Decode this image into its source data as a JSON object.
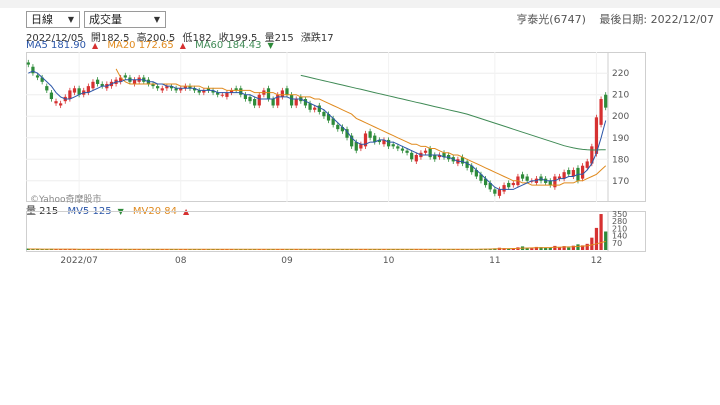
{
  "toolbar": {
    "period_select": "日線",
    "indicator_select": "成交量"
  },
  "stock": {
    "name": "亨泰光(6747)",
    "last_date_label": "最後日期: 2022/12/07"
  },
  "ohlc": {
    "date": "2022/12/05",
    "open": "開182.5",
    "high": "高200.5",
    "low": "低182",
    "close": "收199.5",
    "volume": "量215",
    "change": "漲跌17"
  },
  "ma_legend": {
    "ma5": "MA5 181.90",
    "ma20": "MA20 172.65",
    "ma60": "MA60 184.43"
  },
  "vol_legend": {
    "vol": "量 215",
    "mv5": "MV5 125",
    "mv20": "MV20 84"
  },
  "watermark": "©Yahoo奇摩股市",
  "colors": {
    "up": "#d63131",
    "down": "#2e8b3a",
    "ma5": "#2b56a8",
    "ma20": "#e08a1e",
    "ma60": "#3f8a55",
    "vol_ma": "#e08a1e"
  },
  "chart_data": {
    "type": "candlestick",
    "price_ticks": [
      "220",
      "210",
      "200",
      "190",
      "180",
      "170"
    ],
    "volume_ticks": [
      "350",
      "280",
      "210",
      "140",
      "70"
    ],
    "x_ticks": [
      "2022/07",
      "08",
      "09",
      "10",
      "11",
      "12"
    ],
    "x_tick_index": [
      11,
      33,
      56,
      78,
      101,
      123
    ],
    "ylim": [
      162,
      228
    ],
    "vlim": [
      0,
      360
    ],
    "close": [
      224,
      220,
      218,
      216,
      212,
      208,
      207,
      206,
      209,
      212,
      213,
      210,
      212,
      214,
      216,
      215,
      214,
      215,
      216,
      217,
      218,
      218,
      216,
      217,
      218,
      216,
      215,
      214,
      213,
      213,
      214,
      213,
      212,
      213,
      214,
      213,
      212,
      211,
      212,
      212,
      211,
      210,
      210,
      211,
      212,
      212,
      210,
      208,
      207,
      205,
      210,
      212,
      208,
      205,
      210,
      212,
      210,
      205,
      208,
      207,
      205,
      203,
      204,
      202,
      200,
      198,
      196,
      194,
      193,
      190,
      186,
      184,
      187,
      192,
      190,
      188,
      188,
      189,
      186,
      186,
      185,
      184,
      183,
      180,
      182,
      183,
      184,
      181,
      180,
      182,
      181,
      180,
      179,
      180,
      178,
      176,
      174,
      172,
      170,
      168,
      166,
      164,
      166,
      168,
      167,
      169,
      172,
      171,
      170,
      170,
      171,
      170,
      169,
      168,
      172,
      172,
      174,
      173,
      175,
      170,
      177,
      179,
      186,
      199.5,
      208,
      204
    ],
    "open": [
      225,
      223,
      219,
      218,
      214,
      211,
      206,
      205,
      207,
      208,
      211,
      213,
      210,
      211,
      213,
      217,
      215,
      213,
      214,
      215,
      216,
      219,
      218,
      215,
      216,
      218,
      217,
      215,
      214,
      212,
      213,
      214,
      213,
      212,
      213,
      214,
      213,
      212,
      211,
      213,
      212,
      211,
      210,
      209,
      211,
      213,
      213,
      210,
      209,
      208,
      205,
      210,
      213,
      208,
      205,
      209,
      213,
      210,
      205,
      209,
      208,
      206,
      203,
      205,
      202,
      201,
      199,
      196,
      195,
      194,
      191,
      188,
      185,
      186,
      193,
      191,
      189,
      187,
      189,
      187,
      186,
      185,
      184,
      183,
      179,
      181,
      183,
      185,
      182,
      181,
      183,
      182,
      181,
      178,
      181,
      179,
      177,
      175,
      173,
      171,
      169,
      166,
      163,
      165,
      169,
      168,
      168,
      173,
      172,
      170,
      169,
      172,
      171,
      170,
      167,
      171,
      171,
      175,
      172,
      176,
      171,
      176,
      178,
      182.5,
      196,
      210
    ],
    "volume": [
      14,
      10,
      9,
      9,
      8,
      11,
      9,
      8,
      10,
      9,
      8,
      8,
      7,
      9,
      8,
      8,
      7,
      7,
      8,
      8,
      7,
      8,
      7,
      7,
      8,
      7,
      7,
      7,
      7,
      6,
      7,
      7,
      7,
      6,
      7,
      6,
      6,
      7,
      7,
      6,
      6,
      6,
      7,
      6,
      7,
      6,
      7,
      7,
      8,
      8,
      9,
      8,
      7,
      8,
      8,
      7,
      8,
      9,
      8,
      8,
      7,
      8,
      7,
      8,
      7,
      8,
      7,
      9,
      8,
      8,
      9,
      9,
      8,
      7,
      9,
      8,
      8,
      7,
      8,
      7,
      8,
      8,
      7,
      9,
      8,
      8,
      7,
      8,
      8,
      7,
      7,
      8,
      8,
      7,
      7,
      8,
      9,
      9,
      10,
      12,
      14,
      16,
      22,
      18,
      14,
      15,
      26,
      35,
      20,
      18,
      30,
      28,
      20,
      22,
      40,
      30,
      38,
      25,
      42,
      55,
      45,
      60,
      120,
      215,
      350,
      180
    ],
    "ma5": [
      220,
      221,
      220,
      218,
      216,
      214,
      211,
      209,
      208,
      208,
      209,
      210,
      211,
      211,
      212,
      213,
      214,
      214,
      215,
      216,
      216,
      217,
      217,
      217,
      217,
      217,
      216,
      216,
      215,
      215,
      214,
      214,
      213,
      213,
      213,
      213,
      213,
      212,
      212,
      212,
      212,
      211,
      211,
      211,
      211,
      211,
      211,
      210,
      210,
      209,
      208,
      208,
      208,
      208,
      209,
      209,
      209,
      208,
      208,
      208,
      207,
      206,
      205,
      204,
      203,
      201,
      199,
      197,
      195,
      193,
      190,
      188,
      187,
      187,
      188,
      188,
      189,
      189,
      188,
      188,
      187,
      186,
      185,
      184,
      183,
      182,
      182,
      182,
      182,
      182,
      181,
      181,
      180,
      179,
      179,
      178,
      177,
      175,
      173,
      171,
      169,
      167,
      166,
      166,
      166,
      166,
      167,
      168,
      169,
      170,
      170,
      171,
      170,
      170,
      170,
      171,
      171,
      172,
      172,
      173,
      173,
      175,
      178,
      183,
      190,
      198
    ],
    "ma20": [
      null,
      null,
      null,
      null,
      null,
      null,
      null,
      null,
      null,
      null,
      null,
      null,
      null,
      null,
      null,
      null,
      null,
      null,
      null,
      222,
      218,
      216,
      215,
      215,
      215,
      215,
      215,
      215,
      215,
      215,
      215,
      215,
      215,
      214,
      214,
      214,
      214,
      214,
      213,
      213,
      213,
      213,
      213,
      212,
      212,
      212,
      212,
      212,
      212,
      211,
      211,
      211,
      211,
      211,
      210,
      210,
      210,
      210,
      210,
      209,
      209,
      209,
      208,
      208,
      207,
      206,
      205,
      204,
      203,
      202,
      201,
      199,
      198,
      197,
      196,
      195,
      194,
      193,
      192,
      191,
      190,
      189,
      188,
      187,
      187,
      186,
      186,
      185,
      185,
      184,
      183,
      183,
      182,
      182,
      181,
      180,
      179,
      178,
      177,
      176,
      175,
      174,
      173,
      172,
      171,
      170,
      170,
      169,
      169,
      168,
      168,
      168,
      168,
      168,
      168,
      168,
      169,
      169,
      169,
      170,
      170,
      171,
      172,
      173,
      175,
      177
    ],
    "ma60": [
      null,
      null,
      null,
      null,
      null,
      null,
      null,
      null,
      null,
      null,
      null,
      null,
      null,
      null,
      null,
      null,
      null,
      null,
      null,
      null,
      null,
      null,
      null,
      null,
      null,
      null,
      null,
      null,
      null,
      null,
      null,
      null,
      null,
      null,
      null,
      null,
      null,
      null,
      null,
      null,
      null,
      null,
      null,
      null,
      null,
      null,
      null,
      null,
      null,
      null,
      null,
      null,
      null,
      null,
      null,
      null,
      null,
      null,
      null,
      219,
      218.5,
      218,
      217.5,
      217,
      216.5,
      216,
      215.5,
      215,
      214.5,
      214,
      213.5,
      213,
      212.5,
      212,
      211.5,
      211,
      210.5,
      210,
      209.5,
      209,
      208.5,
      208,
      207.5,
      207,
      206.5,
      206,
      205.5,
      205,
      204.5,
      204,
      203.5,
      203,
      202.5,
      202,
      201.5,
      201,
      200.3,
      199.6,
      198.9,
      198.2,
      197.5,
      196.8,
      196.1,
      195.4,
      194.7,
      194,
      193.3,
      192.6,
      191.9,
      191.2,
      190.5,
      189.8,
      189.1,
      188.4,
      187.7,
      187,
      186.3,
      185.8,
      185.3,
      184.9,
      184.6,
      184.4,
      184.3,
      184.3,
      184.4,
      184.4
    ],
    "vol_ma": [
      10,
      10,
      10,
      9,
      9,
      9,
      9,
      9,
      9,
      9,
      9,
      8,
      8,
      8,
      8,
      8,
      8,
      8,
      8,
      8,
      8,
      8,
      8,
      8,
      8,
      8,
      7,
      7,
      7,
      7,
      7,
      7,
      7,
      7,
      7,
      7,
      7,
      7,
      7,
      7,
      7,
      7,
      7,
      7,
      7,
      7,
      7,
      7,
      7,
      7,
      7,
      8,
      8,
      8,
      8,
      8,
      8,
      8,
      8,
      8,
      8,
      8,
      8,
      8,
      8,
      8,
      8,
      8,
      8,
      8,
      8,
      8,
      8,
      8,
      8,
      8,
      8,
      8,
      8,
      8,
      8,
      8,
      8,
      8,
      8,
      8,
      8,
      8,
      8,
      8,
      8,
      8,
      8,
      8,
      8,
      8,
      8,
      8,
      9,
      9,
      10,
      11,
      12,
      13,
      14,
      15,
      16,
      18,
      19,
      20,
      21,
      22,
      23,
      24,
      26,
      27,
      29,
      30,
      32,
      35,
      38,
      42,
      50,
      60,
      72,
      84
    ]
  }
}
